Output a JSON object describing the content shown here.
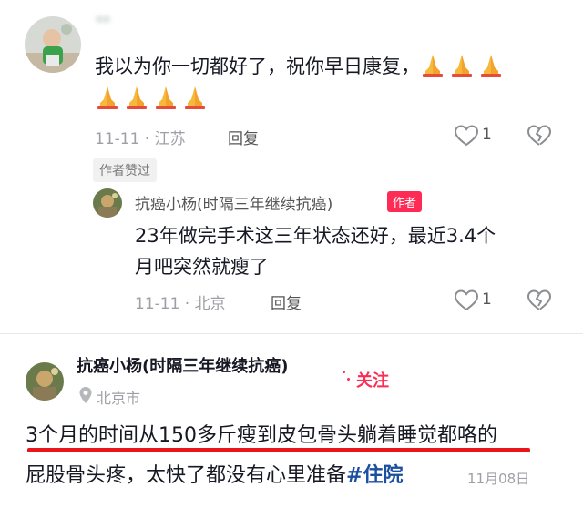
{
  "comment": {
    "username": "**",
    "text": "我以为你一切都好了，祝你早日康复，",
    "date_location": "11-11 · 江苏",
    "reply_label": "回复",
    "like_count": "1",
    "author_liked_chip": "作者赞过",
    "emoji": "folded-hands"
  },
  "author_reply": {
    "name": "抗癌小杨(时隔三年继续抗癌)",
    "tag": "作者",
    "text_line1": "23年做完手术这三年状态还好，最近3.4个",
    "text_line2": "月吧突然就瘦了",
    "date_location": "11-11 · 北京",
    "reply_label": "回复",
    "like_count": "1"
  },
  "post": {
    "author_name": "抗癌小杨(时隔三年继续抗癌)",
    "follow_label": "关注",
    "location": "北京市",
    "text_line1": "3个月的时间从150多斤瘦到皮包骨头躺着睡觉都咯的",
    "text_line2": "屁股骨头疼，太快了都没有心里准备",
    "hashtag": "#住院",
    "date": "11月08日"
  },
  "colors": {
    "accent_red": "#fe2c55",
    "underline_red": "#e8151a",
    "hashtag_blue": "#1b4fa0"
  }
}
